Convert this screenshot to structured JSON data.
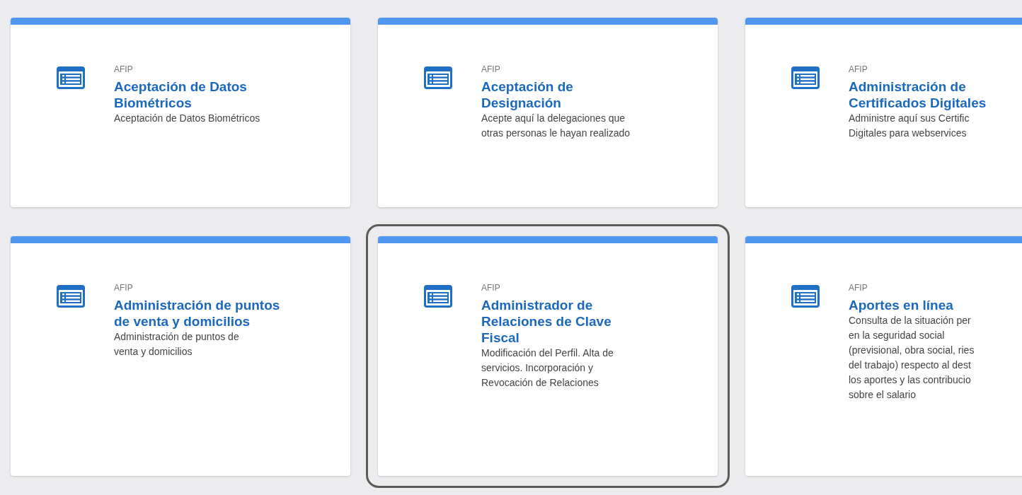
{
  "cards": [
    {
      "source": "AFIP",
      "title": "Aceptación de Datos Biométricos",
      "description": [
        "Aceptación de Datos Biométricos"
      ],
      "selected": false
    },
    {
      "source": "AFIP",
      "title": "Aceptación de Designación",
      "description": [
        "Acepte aquí la delegaciones que",
        "otras personas le hayan realizado"
      ],
      "selected": false
    },
    {
      "source": "AFIP",
      "title": "Administración de Certificados Digitales",
      "description": [
        "Administre aquí sus Certific",
        "Digitales para webservices"
      ],
      "selected": false
    },
    {
      "source": "AFIP",
      "title": "Administración de puntos de venta y domicilios",
      "description": [
        "Administración de puntos de",
        "venta y domicilios"
      ],
      "selected": false
    },
    {
      "source": "AFIP",
      "title": "Administrador de Relaciones de Clave Fiscal",
      "description": [
        "Modificación del Perfil. Alta de",
        "servicios. Incorporación y",
        "Revocación de Relaciones"
      ],
      "selected": true
    },
    {
      "source": "AFIP",
      "title": "Aportes en línea",
      "description": [
        "Consulta de la situación per",
        "en la seguridad social",
        "(previsional, obra social, ries",
        "del trabajo) respecto al dest",
        "los aportes y las contribucio",
        "sobre el salario"
      ],
      "selected": false
    }
  ]
}
